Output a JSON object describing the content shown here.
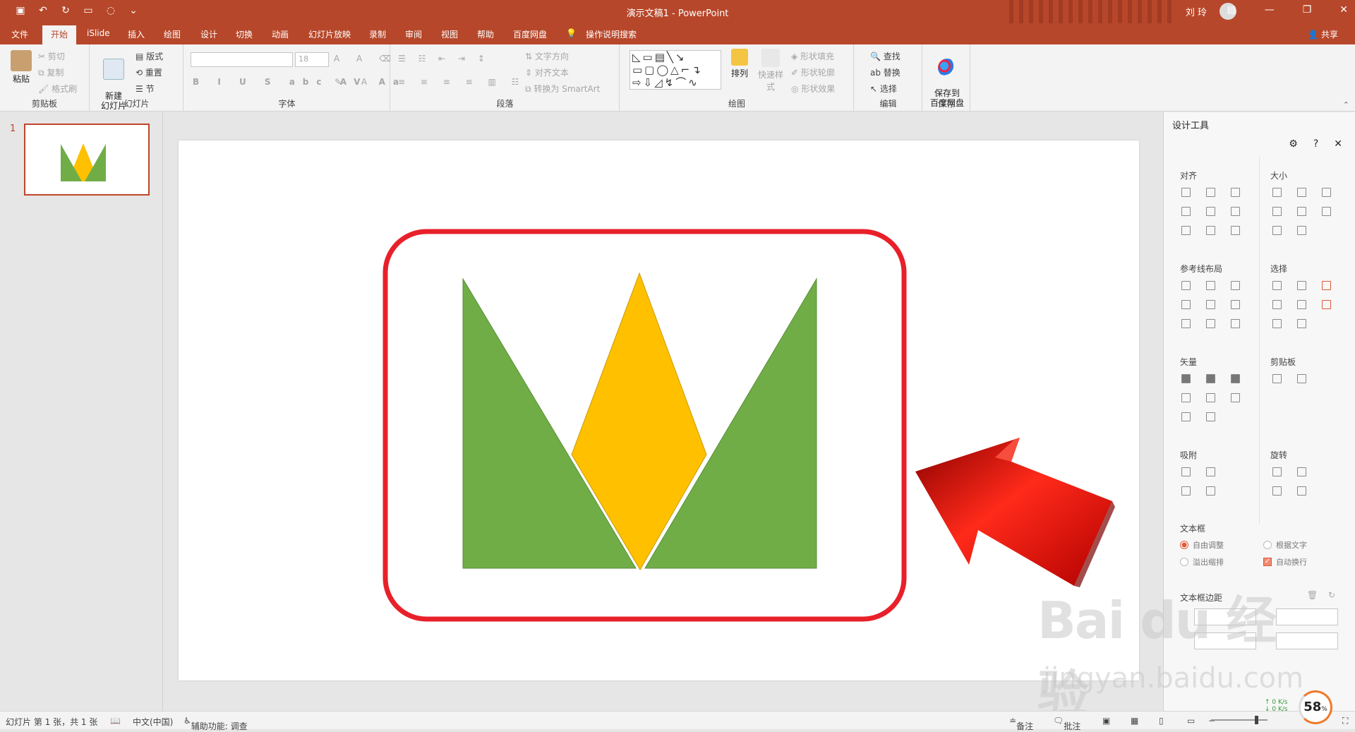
{
  "window": {
    "title": "演示文稿1  -  PowerPoint",
    "user_name": "刘 玲",
    "qat_icons": [
      "save-icon",
      "undo-icon",
      "redo-icon",
      "present-icon",
      "touch-icon",
      "customize-icon"
    ]
  },
  "tabs": [
    "文件",
    "开始",
    "iSlide",
    "插入",
    "绘图",
    "设计",
    "切换",
    "动画",
    "幻灯片放映",
    "录制",
    "审阅",
    "视图",
    "帮助",
    "百度网盘"
  ],
  "active_tab": "开始",
  "search_hint": "操作说明搜索",
  "share_label": "共享",
  "ribbon": {
    "clipboard": {
      "paste": "粘贴",
      "cut": "剪切",
      "copy": "复制",
      "format_painter": "格式刷",
      "name": "剪贴板"
    },
    "slides": {
      "new_slide": "新建\n幻灯片",
      "layout": "版式",
      "reset": "重置",
      "section": "节",
      "name": "幻灯片"
    },
    "font": {
      "name": "字体",
      "size": "18"
    },
    "paragraph": {
      "name": "段落",
      "text_direction": "文字方向",
      "align_text": "对齐文本",
      "smartart": "转换为 SmartArt"
    },
    "drawing": {
      "name": "绘图",
      "arrange": "排列",
      "quick_styles": "快速样式",
      "fill": "形状填充",
      "outline": "形状轮廓",
      "effects": "形状效果"
    },
    "editing": {
      "name": "编辑",
      "find": "查找",
      "replace": "替换",
      "select": "选择"
    },
    "save": {
      "name": "保存",
      "save_to_baidu": "保存到\n百度网盘"
    }
  },
  "slides_panel": {
    "slide_number": "1"
  },
  "design_pane": {
    "title": "设计工具",
    "sections": {
      "align": "对齐",
      "size": "大小",
      "guides": "参考线布局",
      "select": "选择",
      "vector": "矢量",
      "clipboard": "剪贴板",
      "snap": "吸附",
      "rotate": "旋转",
      "textbox": "文本框",
      "margins": "文本框边距"
    },
    "textbox_options": {
      "auto_adjust": "自由调整",
      "fit_text": "根据文字",
      "overflow": "溢出缩排",
      "auto_wrap": "自动换行"
    }
  },
  "status": {
    "slide_info": "幻灯片 第 1 张，共 1 张",
    "language": "中文(中国)",
    "accessibility": "辅助功能: 调查",
    "notes": "备注",
    "comments": "批注",
    "zoom_percent": "58",
    "zoom_suffix": "%",
    "net_up": "0 K/s",
    "net_down": "0 K/s"
  },
  "watermark": {
    "brand": "Bai du 经验",
    "url": "jingyan.baidu.com"
  },
  "colors": {
    "accent": "#b7472a",
    "crown_green": "#70ad47",
    "crown_yellow": "#ffc000",
    "highlight_red": "#e8202a",
    "arrow_red": "#dd1010"
  }
}
